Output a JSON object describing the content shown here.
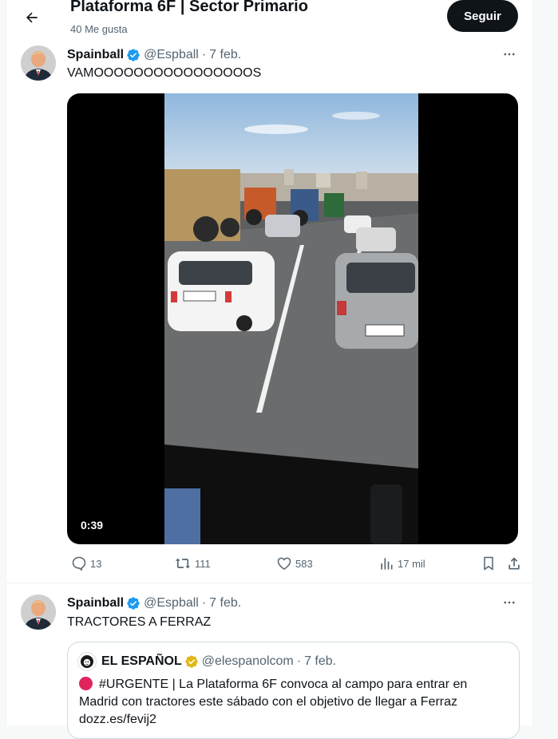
{
  "header": {
    "title": "Plataforma 6F | Sector Primario",
    "subtitle": "40 Me gusta",
    "follow_label": "Seguir"
  },
  "tweets": [
    {
      "name": "Spainball",
      "handle": "@Espball",
      "separator": "·",
      "date": "7 feb.",
      "text": "VAMOOOOOOOOOOOOOOOOS",
      "video": {
        "duration": "0:39"
      },
      "stats": {
        "replies": "13",
        "retweets": "111",
        "likes": "583",
        "views": "17 mil"
      }
    },
    {
      "name": "Spainball",
      "handle": "@Espball",
      "separator": "·",
      "date": "7 feb.",
      "text": "TRACTORES A FERRAZ",
      "quote": {
        "name": "EL ESPAÑOL",
        "handle": "@elespanolcom",
        "separator": "·",
        "date": "7 feb.",
        "hashtag": "#URGENTE",
        "line1_rest": "| La Plataforma 6F convoca al campo para entrar en",
        "line2": "Madrid con tractores este sábado con el objetivo de llegar a Ferraz",
        "line3": "dozz.es/fevij2"
      }
    }
  ],
  "colors": {
    "accent": "#1d9bf0",
    "verified_gold": "#e2b719",
    "text_primary": "#0f1419",
    "text_secondary": "#536471",
    "follow_bg": "#0f1419",
    "urgent_dot": "#e0245e"
  },
  "icons": {
    "back": "arrow-left-icon",
    "more": "more-dots-icon",
    "reply": "reply-icon",
    "retweet": "retweet-icon",
    "like": "heart-icon",
    "views": "views-icon",
    "bookmark": "bookmark-icon",
    "share": "share-icon",
    "verified": "verified-badge-icon"
  }
}
